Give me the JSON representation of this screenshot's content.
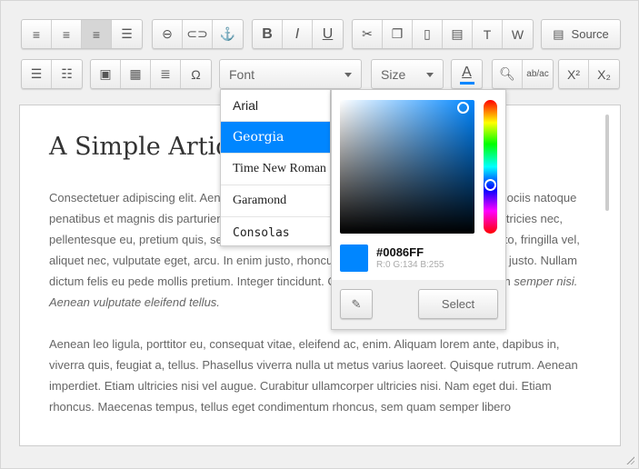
{
  "toolbar": {
    "source_label": "Source",
    "font_label": "Font",
    "size_label": "Size",
    "color_accent": "#0086FF"
  },
  "font_menu": {
    "items": [
      "Arial",
      "Georgia",
      "Time New Roman",
      "Garamond",
      "Consolas"
    ],
    "selected": "Georgia"
  },
  "color_picker": {
    "hex": "#0086FF",
    "rgb": "R:0 G:134 B:255",
    "select_label": "Select"
  },
  "document": {
    "title": "A Simple Article",
    "p1": "Consectetuer adipiscing elit. Aenean commodo ligula eget dolor. Aenean massa. Cum sociis natoque penatibus et magnis dis parturient montes, nascetur ridiculus mus. Donec quam felis, ultricies nec, pellentesque eu, pretium quis, sem. Nulla consequat massa quis enim. Donec pede justo, fringilla vel, aliquet nec, vulputate eget, arcu. In enim justo, rhoncus ut, imperdiet a, venenatis vitae, justo. Nullam dictum felis eu pede mollis pretium. Integer tincidunt. Cras dapibus. Vivamus elementum ",
    "p1_italic": "semper nisi. Aenean vulputate eleifend tellus.",
    "p2": "Aenean leo ligula, porttitor eu, consequat vitae, eleifend ac, enim. Aliquam lorem ante, dapibus in, viverra quis, feugiat a, tellus. Phasellus viverra nulla ut metus varius laoreet. Quisque rutrum. Aenean imperdiet. Etiam ultricies nisi vel augue. Curabitur ullamcorper ultricies nisi. Nam eget dui. Etiam rhoncus. Maecenas tempus, tellus eget condimentum rhoncus, sem quam semper libero"
  }
}
